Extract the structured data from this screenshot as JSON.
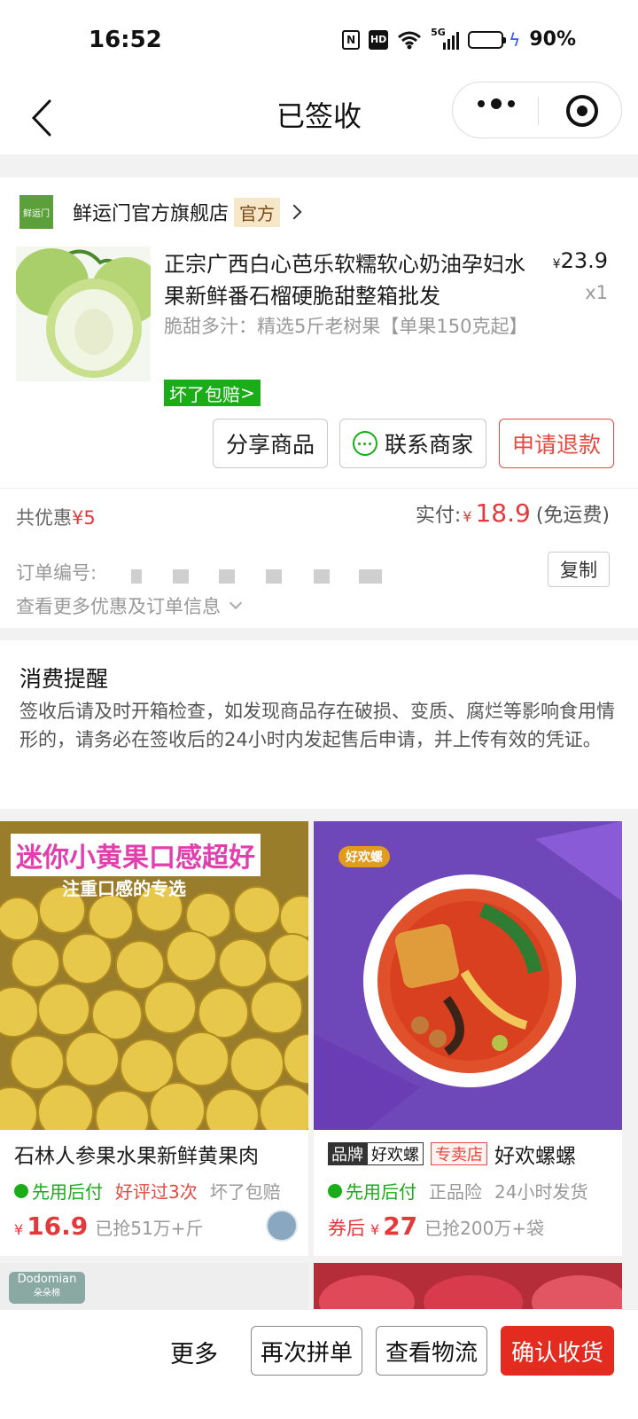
{
  "status_bar": {
    "time": "16:52",
    "nfc": "N",
    "hd": "HD",
    "network": "5G",
    "battery_level": 0.9,
    "battery": "90%"
  },
  "nav": {
    "title": "已签收"
  },
  "store": {
    "logo_text": "鲜运门",
    "name": "鲜运门官方旗舰店",
    "badge": "官方"
  },
  "product": {
    "title": "正宗广西白心芭乐软糯软心奶油孕妇水果新鲜番石榴硬脆甜整箱批发",
    "spec": "脆甜多汁：精选5斤老树果【单果150克起】",
    "currency": "¥",
    "price": "23.9",
    "qty": "x1",
    "guarantee": "坏了包赔"
  },
  "actions": {
    "share": "分享商品",
    "contact": "联系商家",
    "refund": "申请退款"
  },
  "summary": {
    "discount_label": "共优惠",
    "discount_value": "¥5",
    "paid_label": "实付:",
    "currency": "¥",
    "paid_amount": "18.9",
    "shipping": "(免运费)",
    "order_no_label": "订单编号:",
    "copy": "复制",
    "more_info": "查看更多优惠及订单信息"
  },
  "notice": {
    "title": "消费提醒",
    "text": "签收后请及时开箱检查，如发现商品存在破损、变质、腐烂等影响食用情形的，请务必在签收后的24小时内发起售后申请，并上传有效的凭证。"
  },
  "recommend": [
    {
      "img_caption": "迷你小黄果口感超好",
      "img_sub": "注重口感的专选",
      "title": "石林人参果水果新鲜黄果肉",
      "pay_tag": "先用后付",
      "tag2": "好评过3次",
      "tag3": "坏了包赔",
      "currency": "¥",
      "price": "16.9",
      "sold": "已抢51万+斤"
    },
    {
      "brand_a": "品牌",
      "brand_b": "好欢螺",
      "shop_tag": "专卖店",
      "title": "好欢螺螺",
      "pay_tag": "先用后付",
      "tag2": "正品险",
      "tag3": "24小时发货",
      "coupon": "券后",
      "currency": "¥",
      "price": "27",
      "sold": "已抢200万+袋",
      "logo_text": "好欢螺"
    }
  ],
  "recommend_next": {
    "brand": "Dodomian",
    "brand_sub": "朵朵棉"
  },
  "bottom_bar": {
    "more": "更多",
    "rebuy": "再次拼单",
    "logistics": "查看物流",
    "confirm": "确认收货"
  },
  "colors": {
    "accent_red": "#e42b20",
    "price_red": "#e4393c",
    "green": "#1aad19"
  }
}
